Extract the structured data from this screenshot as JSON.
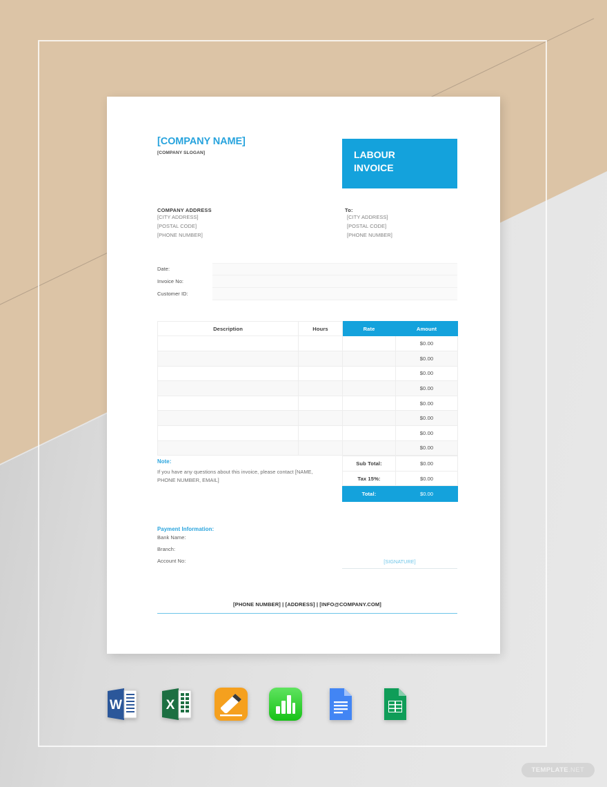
{
  "background": {
    "tan_color": "#dcc4a6",
    "grey_color": "#e4e4e4",
    "accent_blue": "#14a2dc"
  },
  "document": {
    "company_name": "[COMPANY NAME]",
    "company_slogan": "[COMPANY SLOGAN]",
    "invoice_title_line1": "LABOUR",
    "invoice_title_line2": "INVOICE",
    "from": {
      "title": "COMPANY ADDRESS",
      "lines": [
        "[CITY ADDRESS]",
        "[POSTAL CODE]",
        "[PHONE NUMBER]"
      ]
    },
    "to": {
      "title": "To:",
      "lines": [
        "[CITY ADDRESS]",
        "[POSTAL CODE]",
        "[PHONE NUMBER]"
      ]
    },
    "meta_fields": [
      {
        "label": "Date:",
        "value": ""
      },
      {
        "label": "Invoice No:",
        "value": ""
      },
      {
        "label": "Customer ID:",
        "value": ""
      }
    ],
    "table": {
      "headers": [
        "Description",
        "Hours",
        "Rate",
        "Amount"
      ],
      "rows": [
        {
          "description": "",
          "hours": "",
          "rate": "",
          "amount": "$0.00"
        },
        {
          "description": "",
          "hours": "",
          "rate": "",
          "amount": "$0.00"
        },
        {
          "description": "",
          "hours": "",
          "rate": "",
          "amount": "$0.00"
        },
        {
          "description": "",
          "hours": "",
          "rate": "",
          "amount": "$0.00"
        },
        {
          "description": "",
          "hours": "",
          "rate": "",
          "amount": "$0.00"
        },
        {
          "description": "",
          "hours": "",
          "rate": "",
          "amount": "$0.00"
        },
        {
          "description": "",
          "hours": "",
          "rate": "",
          "amount": "$0.00"
        },
        {
          "description": "",
          "hours": "",
          "rate": "",
          "amount": "$0.00"
        }
      ]
    },
    "note": {
      "title": "Note:",
      "body": "If you have any questions about this invoice, please contact [NAME, PHONE NUMBER, EMAIL]"
    },
    "totals": [
      {
        "label": "Sub Total:",
        "value": "$0.00"
      },
      {
        "label": "Tax 15%:",
        "value": "$0.00"
      },
      {
        "label": "Total:",
        "value": "$0.00"
      }
    ],
    "payment": {
      "title": "Payment Information:",
      "lines": [
        "Bank Name:",
        "Branch:",
        "Account No:"
      ],
      "signature_label": "[SIGNATURE]"
    },
    "footer": "[PHONE NUMBER] | [ADDRESS] | [INFO@COMPANY.COM]"
  },
  "apps": [
    {
      "name": "microsoft-word",
      "label": "W"
    },
    {
      "name": "microsoft-excel",
      "label": "X"
    },
    {
      "name": "apple-pages",
      "label": ""
    },
    {
      "name": "apple-numbers",
      "label": ""
    },
    {
      "name": "google-docs",
      "label": ""
    },
    {
      "name": "google-sheets",
      "label": ""
    }
  ],
  "watermark": {
    "bold": "TEMPLATE",
    "light": ".NET"
  }
}
